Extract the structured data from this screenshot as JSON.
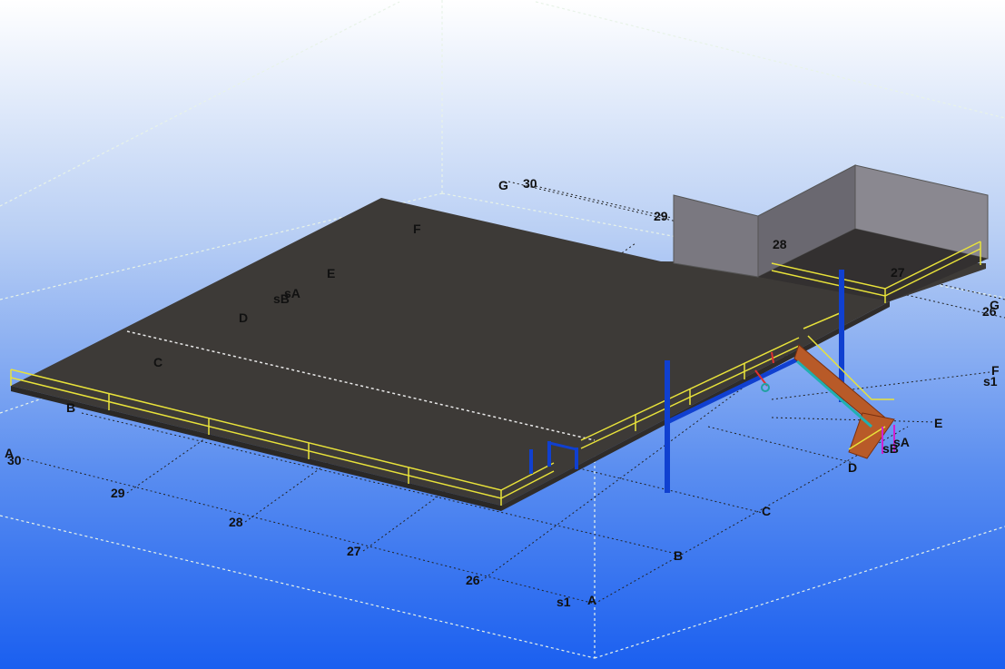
{
  "viewport": {
    "background_top": "#ffffff",
    "background_bottom": "#1a5ff0",
    "slab_color": "#3d3a37",
    "wall_color": "#7a7880",
    "handrail_color": "#e8e23a",
    "column_color": "#1040d0",
    "stair_color": "#b85a28"
  },
  "grid_labels": {
    "g_top": "G",
    "n30_top": "30",
    "n29_top": "29",
    "n28_top": "28",
    "n27_top": "27",
    "f_top": "F",
    "e_top": "E",
    "sa_top": "sA",
    "sb_top": "sB",
    "d_top": "D",
    "c_top": "C",
    "b_left": "B",
    "a_left": "A",
    "n30_left": "30",
    "n29_bottom": "29",
    "n28_bottom": "28",
    "n27_bottom": "27",
    "n26_bottom": "26",
    "s1_bottom": "s1",
    "a_bottom": "A",
    "b_bottom": "B",
    "c_bottom": "C",
    "d_right": "D",
    "sb_right": "sB",
    "sa_right": "sA",
    "e_right": "E",
    "f_right": "F",
    "s1_right": "s1",
    "n26_right": "26",
    "g_right": "G"
  }
}
